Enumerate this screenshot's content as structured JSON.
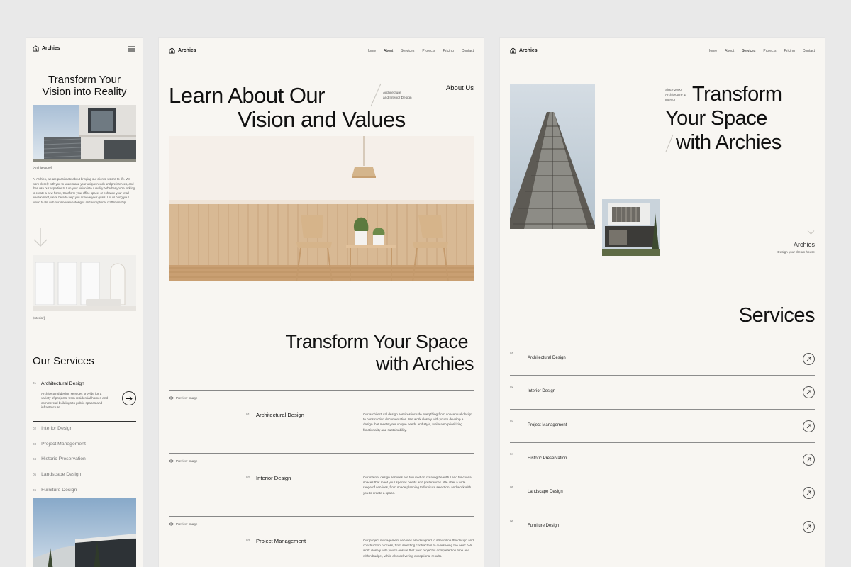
{
  "brand": "Archies",
  "mobile": {
    "hero_title_1": "Transform Your",
    "hero_title_2": "Vision into Reality",
    "caption_architecture": "[Architecture]",
    "caption_interior": "[Interior]",
    "paragraph": "At Archies, we are passionate about bringing our clients' visions to life. We work closely with you to understand your unique needs and preferences, and then use our expertise to turn your vision into a reality. Whether you're looking to create a new home, transform your office space, or enhance your retail environment, we're here to help you achieve your goals. Let us bring your vision to life with our innovative designs and exceptional craftsmanship.",
    "services_title": "Our Services",
    "services": [
      {
        "num": "01",
        "label": "Architectural Design",
        "desc": "Architectural design services provide for a variety of projects, from residential homes and commercial buildings to public spaces and infrastructure."
      },
      {
        "num": "02",
        "label": "Interior Design"
      },
      {
        "num": "03",
        "label": "Project Management"
      },
      {
        "num": "04",
        "label": "Historic Preservation"
      },
      {
        "num": "05",
        "label": "Landscape Design"
      },
      {
        "num": "06",
        "label": "Furniture Design"
      }
    ]
  },
  "about": {
    "nav": [
      "Home",
      "About",
      "Services",
      "Projects",
      "Pricing",
      "Contact"
    ],
    "title_1": "Learn About Our",
    "title_2": "Vision and Values",
    "tag_1": "Architecture",
    "tag_2": "and Interior Design",
    "about_us": "About Us",
    "transform_1": "Transform Your Space",
    "transform_2": "with Archies",
    "preview_label": "Preview Image",
    "services": [
      {
        "num": "01",
        "label": "Architectural Design",
        "desc": "Our architectural design services include everything from conceptual design to construction documentation. We work closely with you to develop a design that meets your unique needs and style, while also prioritizing functionality and sustainability."
      },
      {
        "num": "02",
        "label": "Interior Design",
        "desc": "Our interior design services are focused on creating beautiful and functional spaces that meet your specific needs and preferences. We offer a wide range of services, from space planning to furniture selection, and work with you to create a space."
      },
      {
        "num": "03",
        "label": "Project Management",
        "desc": "Our project management services are designed to streamline the design and construction process, from selecting contractors to overseeing the work. We work closely with you to ensure that your project is completed on time and within budget, while also delivering exceptional results."
      }
    ]
  },
  "services_page": {
    "nav": [
      "Home",
      "About",
      "Services",
      "Projects",
      "Pricing",
      "Contact"
    ],
    "since_1": "Since 2000",
    "since_2": "Architecture &",
    "since_3": "Interior",
    "title_1": "Transform",
    "title_2": "Your Space",
    "title_3": "with Archies",
    "brand_label": "Archies",
    "brand_sub": "Design your dream house",
    "services_title": "Services",
    "services": [
      {
        "num": "01",
        "label": "Architectural Design"
      },
      {
        "num": "02",
        "label": "Interior Design"
      },
      {
        "num": "03",
        "label": "Project Management"
      },
      {
        "num": "04",
        "label": "Historic Preservation"
      },
      {
        "num": "05",
        "label": "Landscape Design"
      },
      {
        "num": "06",
        "label": "Furniture Design"
      }
    ]
  },
  "colors": {
    "page_bg": "#e9e9e9",
    "panel_bg": "#f8f6f2",
    "text": "#111111",
    "muted": "#555555"
  }
}
